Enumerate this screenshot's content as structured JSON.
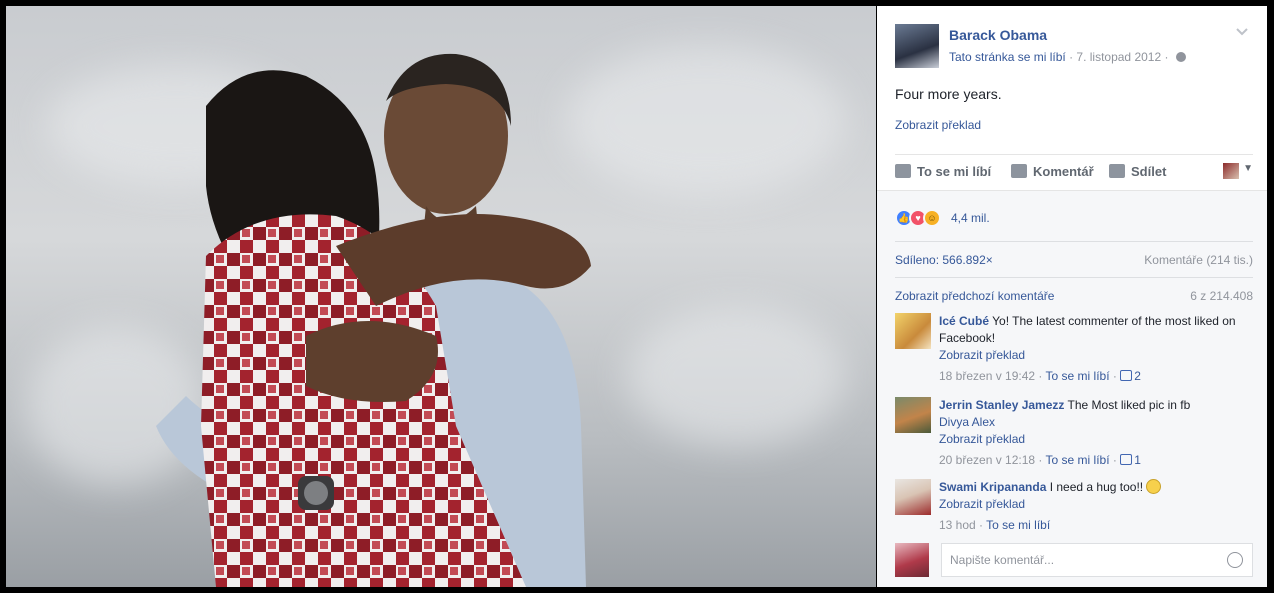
{
  "post": {
    "page_name": "Barack Obama",
    "like_page": "Tato stránka se mi líbí",
    "separator": "·",
    "date": "7. listopad 2012",
    "text": "Four more years.",
    "translate": "Zobrazit překlad"
  },
  "actions": {
    "like": "To se mi líbí",
    "comment": "Komentář",
    "share": "Sdílet"
  },
  "feedback": {
    "reactions_count": "4,4 mil.",
    "shares": "Sdíleno: 566.892×",
    "comments_total": "Komentáře (214 tis.)",
    "prev_comments": "Zobrazit předchozí komentáře",
    "comment_counter": "6 z 214.408"
  },
  "comments": [
    {
      "author": "Icé Cubé",
      "text": "Yo! The latest commenter of the most liked on Facebook!",
      "mention": "",
      "translate": "Zobrazit překlad",
      "time": "18 březen v 19:42",
      "like": "To se mi líbí",
      "likes": "2"
    },
    {
      "author": "Jerrin Stanley Jamezz",
      "text": "The Most liked pic in fb",
      "mention": "Divya Alex",
      "translate": "Zobrazit překlad",
      "time": "20 březen v 12:18",
      "like": "To se mi líbí",
      "likes": "1"
    },
    {
      "author": "Swami Kripananda",
      "text": "I need a hug too!!",
      "mention": "",
      "translate": "Zobrazit překlad",
      "time": "13 hod",
      "like": "To se mi líbí",
      "likes": ""
    }
  ],
  "composer": {
    "placeholder": "Napište komentář..."
  },
  "icons": {
    "reactions": [
      "like-icon",
      "love-icon",
      "haha-icon"
    ],
    "globe": "globe-icon",
    "emoji": "emoji-icon"
  }
}
